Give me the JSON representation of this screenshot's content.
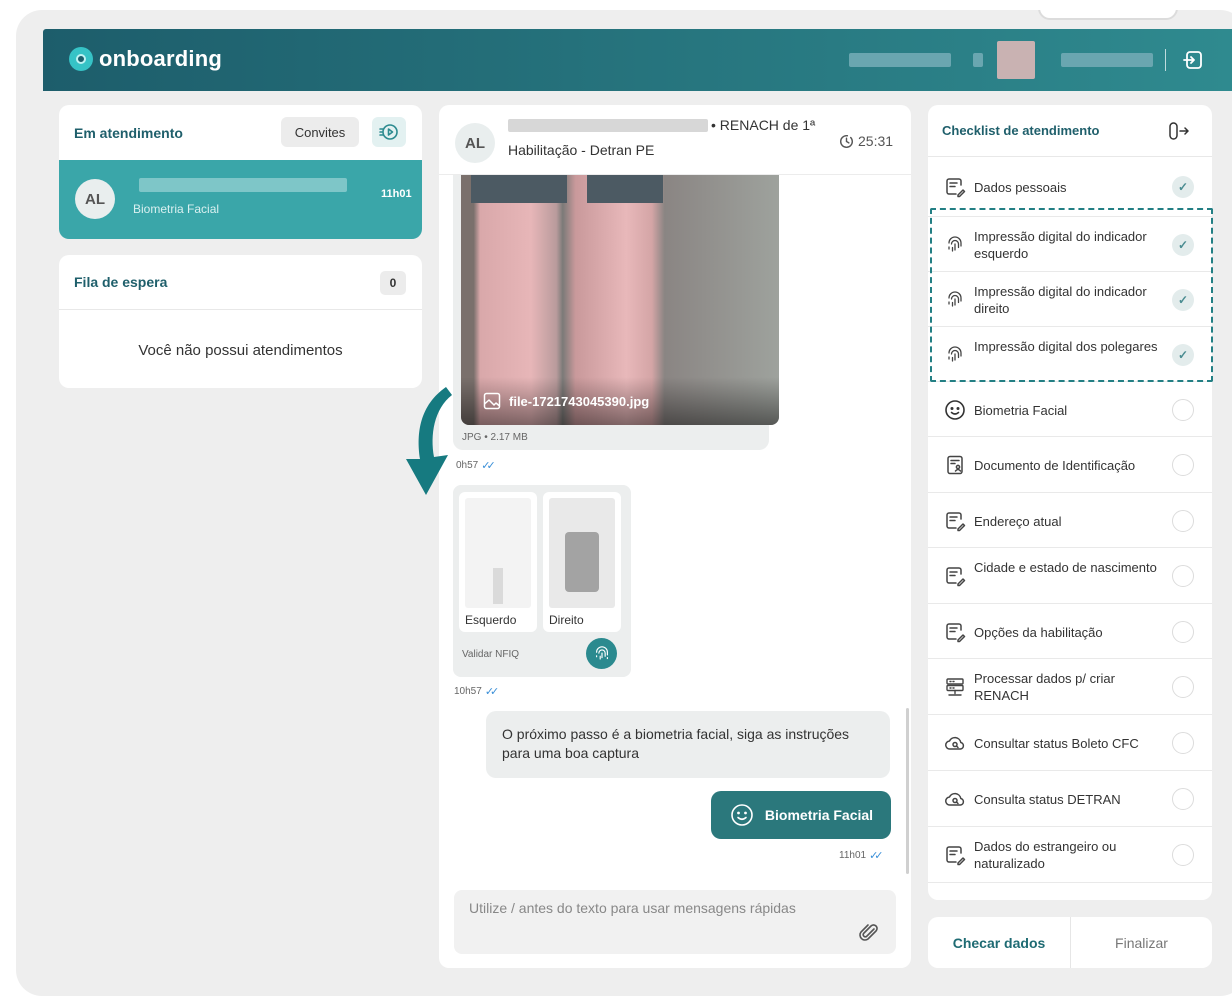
{
  "header": {
    "logo_text": "onboarding"
  },
  "left": {
    "in_service_title": "Em atendimento",
    "invites_label": "Convites",
    "active": {
      "initials": "AL",
      "subtitle": "Biometria Facial",
      "time": "11h01"
    },
    "queue_title": "Fila de espera",
    "queue_count": "0",
    "empty_text": "Você não possui atendimentos"
  },
  "chat": {
    "initials": "AL",
    "title_suffix": "• RENACH de 1ª",
    "title_line2": "Habilitação - Detran PE",
    "timer": "25:31",
    "image_msg": {
      "file_name": "file-1721743045390.jpg",
      "file_meta": "JPG • 2.17 MB",
      "time": "0h57"
    },
    "finger_msg": {
      "left_label": "Esquerdo",
      "right_label": "Direito",
      "validate_label": "Validar NFIQ",
      "time": "10h57"
    },
    "text_msg": "O próximo passo é a biometria facial, siga as instruções para uma boa captura",
    "action_msg": {
      "label": "Biometria Facial",
      "time": "11h01"
    },
    "composer_placeholder": "Utilize / antes do texto para usar mensagens rápidas"
  },
  "checklist": {
    "title": "Checklist de atendimento",
    "items": [
      {
        "label": "Dados pessoais",
        "icon": "form-edit-icon",
        "done": true
      },
      {
        "label": "Impressão digital do indicador esquerdo",
        "icon": "fingerprint-icon",
        "done": true
      },
      {
        "label": "Impressão digital do indicador direito",
        "icon": "fingerprint-icon",
        "done": true
      },
      {
        "label": "Impressão digital dos polegares",
        "icon": "fingerprint-icon",
        "done": true
      },
      {
        "label": "Biometria Facial",
        "icon": "face-icon",
        "done": false
      },
      {
        "label": "Documento de Identificação",
        "icon": "id-document-icon",
        "done": false
      },
      {
        "label": "Endereço atual",
        "icon": "form-edit-icon",
        "done": false
      },
      {
        "label": "Cidade e estado de nascimento",
        "icon": "form-edit-icon",
        "done": false
      },
      {
        "label": "Opções da habilitação",
        "icon": "form-edit-icon",
        "done": false
      },
      {
        "label": "Processar dados p/ criar RENACH",
        "icon": "server-icon",
        "done": false
      },
      {
        "label": "Consultar status Boleto CFC",
        "icon": "cloud-search-icon",
        "done": false
      },
      {
        "label": "Consulta status DETRAN",
        "icon": "cloud-search-icon",
        "done": false
      },
      {
        "label": "Dados do estrangeiro ou naturalizado",
        "icon": "form-edit-icon",
        "done": false
      }
    ],
    "check_button": "Checar dados",
    "finish_button": "Finalizar"
  },
  "colors": {
    "brand_dark": "#1d5d6b",
    "brand": "#2b8a8f",
    "active_item": "#3aa6a9"
  }
}
